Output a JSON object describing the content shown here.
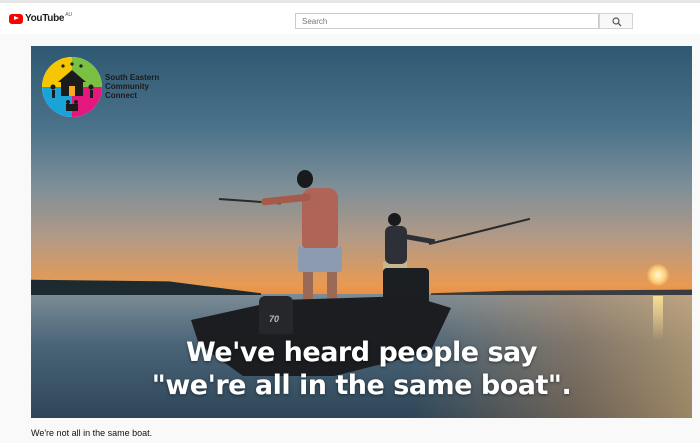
{
  "header": {
    "logo_text": "YouTube",
    "country_code": "AU",
    "search_placeholder": "Search"
  },
  "video": {
    "logo_org_line1": "South Eastern",
    "logo_org_line2": "Community",
    "logo_org_line3": "Connect",
    "engine_label": "70",
    "caption_line1": "We've heard people say",
    "caption_line2": "\"we're all in the same boat\"."
  },
  "description": "We're not all in the same boat.",
  "colors": {
    "youtube_red": "#ff0000",
    "logo_yellow": "#f6c700",
    "logo_pink": "#e4177f",
    "logo_green": "#79c043",
    "logo_blue": "#1aa3d6"
  }
}
